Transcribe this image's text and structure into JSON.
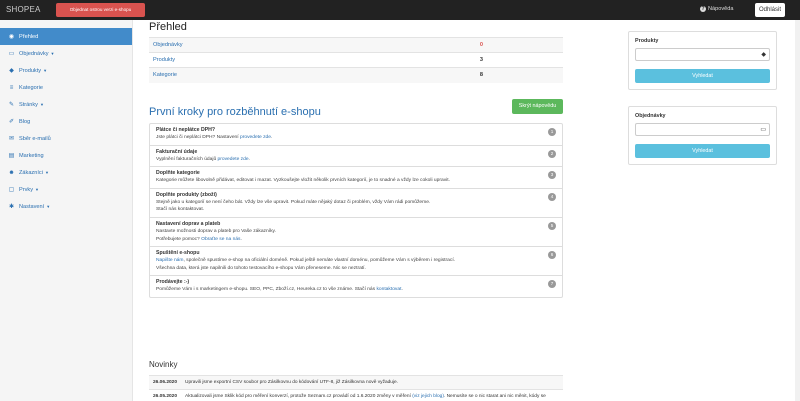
{
  "topbar": {
    "brand": "SHOPEA",
    "order_button": "Objednat ostrou verzi e-shopu",
    "help_label": "Nápověda",
    "logout_button": "Odhlásit"
  },
  "sidebar": {
    "items": [
      {
        "label": "Přehled",
        "icon": "dashboard-icon",
        "glyph": "◉",
        "active": true
      },
      {
        "label": "Objednávky",
        "icon": "basket-icon",
        "glyph": "▭",
        "caret": true
      },
      {
        "label": "Produkty",
        "icon": "cubes-icon",
        "glyph": "◆",
        "caret": true
      },
      {
        "label": "Kategorie",
        "icon": "list-icon",
        "glyph": "≡"
      },
      {
        "label": "Stránky",
        "icon": "edit-icon",
        "glyph": "✎",
        "caret": true
      },
      {
        "label": "Blog",
        "icon": "pencil-icon",
        "glyph": "✐"
      },
      {
        "label": "Sběr e-mailů",
        "icon": "envelope-icon",
        "glyph": "✉"
      },
      {
        "label": "Marketing",
        "icon": "chart-icon",
        "glyph": "▤"
      },
      {
        "label": "Zákazníci",
        "icon": "users-icon",
        "glyph": "☻",
        "caret": true
      },
      {
        "label": "Prvky",
        "icon": "elements-icon",
        "glyph": "▢",
        "caret": true
      },
      {
        "label": "Nastavení",
        "icon": "gear-icon",
        "glyph": "✱",
        "caret": true
      }
    ],
    "caret_glyph": "▼"
  },
  "main": {
    "title": "Přehled",
    "overview": [
      {
        "label": "Objednávky",
        "value": "0"
      },
      {
        "label": "Produkty",
        "value": "3"
      },
      {
        "label": "Kategorie",
        "value": "8"
      }
    ],
    "steps_title": "První kroky pro rozběhnutí e-shopu",
    "hide_button": "Skrýt nápovědu",
    "steps": [
      {
        "num": "1",
        "title": "Plátce či neplátce DPH?",
        "lines": [
          [
            {
              "t": "Jste plátci či neplátci DPH? Nastavení "
            },
            {
              "t": "provedete zde",
              "link": true
            },
            {
              "t": "."
            }
          ]
        ]
      },
      {
        "num": "2",
        "title": "Fakturační údaje",
        "lines": [
          [
            {
              "t": "Vyplnění fakturačních údajů "
            },
            {
              "t": "provedete zde",
              "link": true
            },
            {
              "t": "."
            }
          ]
        ]
      },
      {
        "num": "3",
        "title": "Doplňte kategorie",
        "lines": [
          [
            {
              "t": "Kategorie můžete libovolně přidávat, editovat i mazat. Vyzkoušejte vložit několik prvních kategorií, je to snadné a vždy lze cokoli upravit."
            }
          ]
        ]
      },
      {
        "num": "4",
        "title": "Doplňte produkty (zboží)",
        "lines": [
          [
            {
              "t": "Stejně jako u kategorií se není čeho bát. Vždy lze vše upravit. Pokud máte nějaký dotaz či problém, vždy Vám rádi pomůžeme."
            }
          ],
          [
            {
              "t": "Stačí nás kontaktovat."
            }
          ]
        ]
      },
      {
        "num": "5",
        "title": "Nastavení doprav a plateb",
        "lines": [
          [
            {
              "t": "Nastavte možnosti doprav a plateb pro Vaše zákazníky."
            }
          ],
          [
            {
              "t": "Potřebujete pomoc? "
            },
            {
              "t": "Obraťte se na nás",
              "link": true
            },
            {
              "t": "."
            }
          ]
        ]
      },
      {
        "num": "6",
        "title": "Spuštění e-shopu",
        "lines": [
          [
            {
              "t": "Napište nám",
              "link": true
            },
            {
              "t": ", společně spustíme e-shop na oficiální doméně. Pokud ještě nemáte vlastní doménu, pomůžeme Vám s výběrem i registrací."
            }
          ],
          [
            {
              "t": "Všechna data, která jste napilnili do tohoto testovacího e-shopu Vám přeneseme. Nic se neztratí."
            }
          ]
        ]
      },
      {
        "num": "7",
        "title": "Prodávejte :-)",
        "lines": [
          [
            {
              "t": "Pomůžeme Vám i s marketingem e-shopu. SEO, PPC, Zboží.cz, Heureka.cz to vše známe. Stačí nás "
            },
            {
              "t": "kontaktovat",
              "link": true
            },
            {
              "t": "."
            }
          ]
        ]
      }
    ],
    "news_title": "Novinky",
    "news": [
      {
        "date": "26.06.2020",
        "parts": [
          {
            "t": "Upravili jsme exportní CSV soubor pro Zásilkovnu do kódování UTF-8, již Zásilkovna nově vyžaduje."
          }
        ]
      },
      {
        "date": "26.05.2020",
        "parts": [
          {
            "t": "Aktualizovali jsme Sklik kód pro měření konverzí, protože Seznam.cz provádí od 1.6.2020 změny v měření "
          },
          {
            "t": "(viz jejich blog)",
            "link": true
          },
          {
            "t": ". Nemusíte se o nic starat ani nic měnit, kódy se"
          }
        ]
      }
    ]
  },
  "panels": [
    {
      "title": "Produkty",
      "icon": "cubes-icon",
      "glyph": "◆",
      "button": "Vyhledat"
    },
    {
      "title": "Objednávky",
      "icon": "basket-icon",
      "glyph": "▭",
      "button": "Vyhledat"
    }
  ],
  "colors": {
    "primary": "#428bca",
    "danger": "#d9534f",
    "success": "#5cb85c",
    "info": "#5bc0de",
    "topbar": "#222222"
  }
}
